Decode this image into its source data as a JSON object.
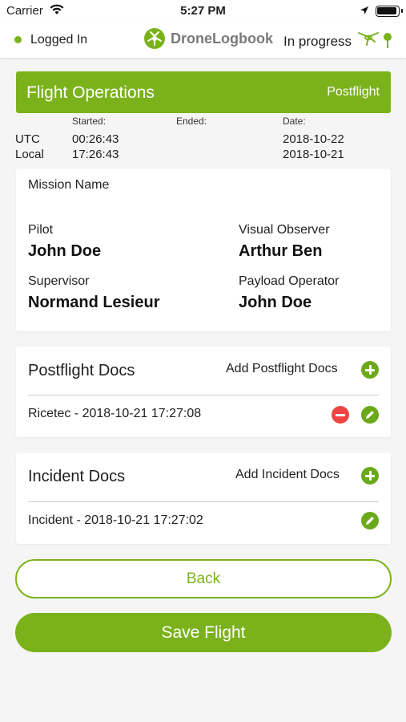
{
  "status_bar": {
    "carrier": "Carrier",
    "time": "5:27 PM",
    "icons": [
      "wifi-icon",
      "location-arrow-icon",
      "battery-icon"
    ]
  },
  "app_bar": {
    "login_status": "Logged In",
    "login_status_color": "#7bb21c",
    "brand": "DroneLogbook",
    "flight_status": "In progress",
    "icons": [
      "dronelogbook-logo-icon",
      "drone-icon",
      "location-pin-icon"
    ]
  },
  "operations": {
    "title": "Flight Operations",
    "phase": "Postflight",
    "accent_color": "#7bb21c"
  },
  "times": {
    "started_label": "Started:",
    "ended_label": "Ended:",
    "date_label": "Date:",
    "rows": [
      {
        "zone": "UTC",
        "started": "00:26:43",
        "ended": "",
        "date": "2018-10-22"
      },
      {
        "zone": "Local",
        "started": "17:26:43",
        "ended": "",
        "date": "2018-10-21"
      }
    ]
  },
  "mission": {
    "name_label": "Mission Name",
    "name_value": "",
    "pilot_label": "Pilot",
    "pilot": "John Doe",
    "observer_label": "Visual Observer",
    "observer": "Arthur Ben",
    "supervisor_label": "Supervisor",
    "supervisor": "Normand Lesieur",
    "payload_label": "Payload Operator",
    "payload": "John Doe"
  },
  "postflight_docs": {
    "title": "Postflight Docs",
    "add_label": "Add Postflight Docs",
    "items": [
      {
        "name": "Ricetec - 2018-10-21 17:27:08",
        "actions": [
          "remove-icon",
          "edit-icon"
        ]
      }
    ]
  },
  "incident_docs": {
    "title": "Incident Docs",
    "add_label": "Add Incident Docs",
    "items": [
      {
        "name": "Incident - 2018-10-21 17:27:02",
        "actions": [
          "edit-icon"
        ]
      }
    ]
  },
  "actions": {
    "back_label": "Back",
    "save_label": "Save Flight"
  },
  "colors": {
    "brand_green": "#7bb21c",
    "remove_red": "#ee4444",
    "background": "#f5f5f5"
  }
}
